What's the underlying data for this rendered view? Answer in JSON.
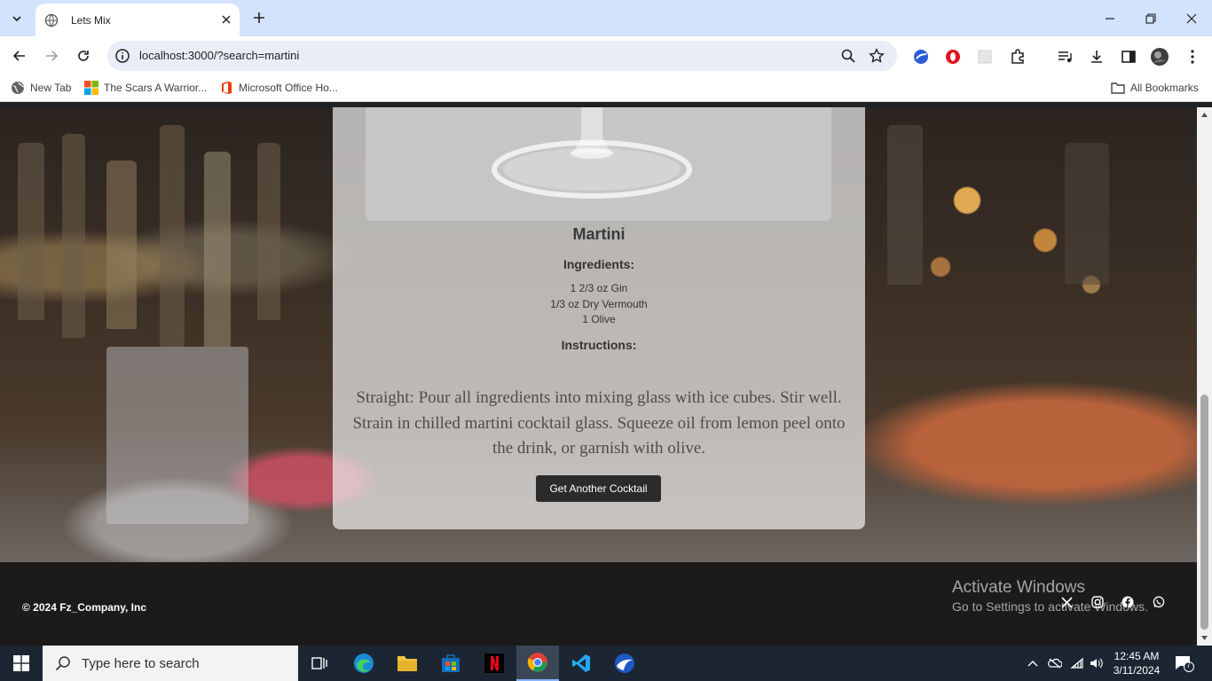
{
  "browser": {
    "tab_title": "Lets Mix",
    "url": "localhost:3000/?search=martini",
    "bookmarks": [
      {
        "label": "New Tab",
        "icon": "globe-icon"
      },
      {
        "label": "The Scars A Warrior...",
        "icon": "windows-logo-icon"
      },
      {
        "label": "Microsoft Office Ho...",
        "icon": "office-icon"
      }
    ],
    "all_bookmarks_label": "All Bookmarks"
  },
  "drink": {
    "name": "Martini",
    "ingredients_heading": "Ingredients:",
    "ingredients": [
      "1 2/3 oz Gin",
      "1/3 oz Dry Vermouth",
      "1 Olive"
    ],
    "instructions_heading": "Instructions:",
    "instructions": "Straight: Pour all ingredients into mixing glass with ice cubes. Stir well. Strain in chilled martini cocktail glass. Squeeze oil from lemon peel onto the drink, or garnish with olive.",
    "button_label": "Get Another Cocktail"
  },
  "footer": {
    "copyright": "© 2024 Fz_Company, Inc",
    "social_icons": [
      "x-icon",
      "instagram-icon",
      "facebook-icon",
      "whatsapp-icon"
    ]
  },
  "watermark": {
    "line1": "Activate Windows",
    "line2": "Go to Settings to activate Windows."
  },
  "taskbar": {
    "search_placeholder": "Type here to search",
    "time": "12:45 AM",
    "date": "3/11/2024",
    "notification_count": "7"
  }
}
